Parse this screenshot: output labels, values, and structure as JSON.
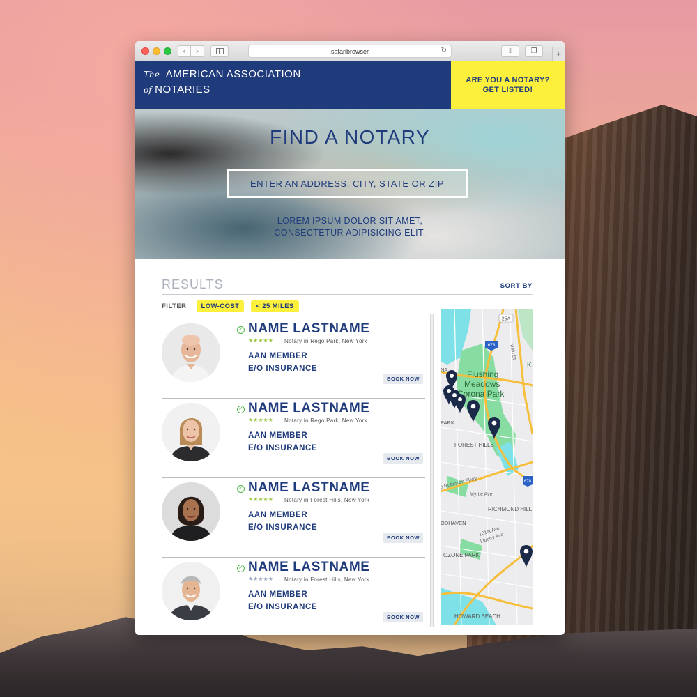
{
  "browser": {
    "url": "safaribrowser",
    "back_glyph": "‹",
    "forward_glyph": "›",
    "reload_glyph": "↻",
    "share_glyph": "⇪",
    "tabs_glyph": "❐",
    "newtab_glyph": "+"
  },
  "header": {
    "logo_the": "The",
    "logo_line1": "AMERICAN ASSOCIATION",
    "logo_of": "of",
    "logo_line2": "NOTARIES",
    "cta_line1": "ARE YOU A NOTARY?",
    "cta_line2": "GET LISTED!",
    "brand_color": "#1f3b7c",
    "accent_color": "#fdf03c"
  },
  "hero": {
    "title": "FIND A NOTARY",
    "search_placeholder": "ENTER AN ADDRESS, CITY, STATE OR ZIP",
    "subtitle_line1": "LOREM IPSUM DOLOR SIT AMET,",
    "subtitle_line2": "CONSECTETUR ADIPISICING ELIT."
  },
  "results": {
    "title": "RESULTS",
    "sort_label": "SORT BY",
    "filter_label": "FILTER",
    "filters": [
      "LOW-COST",
      "< 25 MILES"
    ]
  },
  "notaries": [
    {
      "name": "NAME LASTNAME",
      "stars": "★★★★★",
      "location": "Notary in Rego Park, New York",
      "member": "AAN MEMBER",
      "insurance": "E/O INSURANCE",
      "book": "BOOK NOW"
    },
    {
      "name": "NAME LASTNAME",
      "stars": "★★★★★",
      "location": "Notary in Rego Park, New York",
      "member": "AAN MEMBER",
      "insurance": "E/O INSURANCE",
      "book": "BOOK NOW"
    },
    {
      "name": "NAME LASTNAME",
      "stars": "★★★★★",
      "location": "Notary in Forest Hills, New York",
      "member": "AAN MEMBER",
      "insurance": "E/O INSURANCE",
      "book": "BOOK NOW"
    },
    {
      "name": "NAME LASTNAME",
      "stars": "★★★★★",
      "location": "Notary in Forest Hills, New York",
      "member": "AAN MEMBER",
      "insurance": "E/O INSURANCE",
      "book": "BOOK NOW"
    }
  ],
  "map": {
    "labels": {
      "flushing1": "Flushing",
      "flushing2": "Meadows",
      "flushing3": "Corona Park",
      "forest_hills": "FOREST HILLS",
      "richmond_hill": "RICHMOND HILL",
      "ozone_park": "OZONE PARK",
      "howard_beach": "HOWARD BEACH",
      "myrtle": "Myrtle Ave",
      "robinson": "e Robinson Pkwy",
      "liberty": "Liberty Ave",
      "st101": "101st Ave",
      "haven": "ODHAVEN",
      "park": "PARK",
      "na": "NA",
      "k": "K",
      "main_st": "Main St",
      "route25a": "25A",
      "route678": "678",
      "route678b": "678"
    }
  }
}
